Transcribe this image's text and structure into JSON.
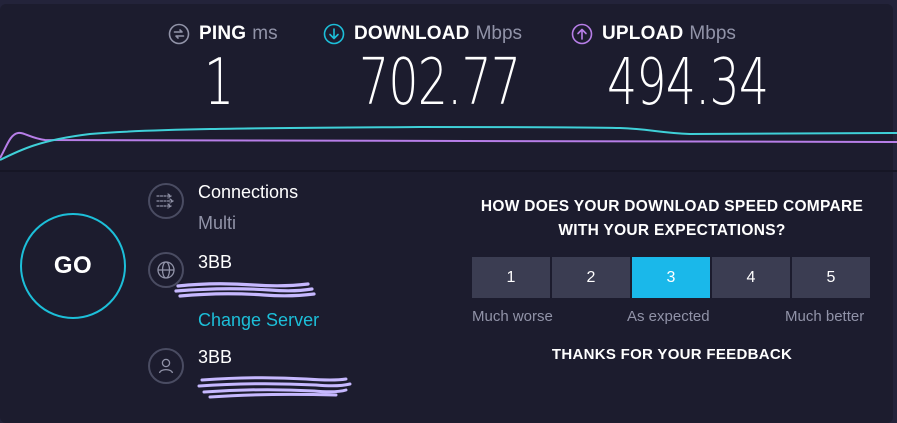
{
  "metrics": {
    "ping": {
      "label": "PING",
      "unit": "ms",
      "value": "1",
      "icon": "ping-icon",
      "color": "#9193a8"
    },
    "download": {
      "label": "DOWNLOAD",
      "unit": "Mbps",
      "value": "702.77",
      "icon": "download-arrow-icon",
      "color": "#1cbfd9"
    },
    "upload": {
      "label": "UPLOAD",
      "unit": "Mbps",
      "value": "494.34",
      "icon": "upload-arrow-icon",
      "color": "#b77ee8"
    }
  },
  "go_label": "GO",
  "connections": {
    "title": "Connections",
    "mode": "Multi"
  },
  "server": {
    "isp": "3BB",
    "change_link": "Change Server"
  },
  "user": {
    "isp": "3BB"
  },
  "feedback": {
    "question_line1": "HOW DOES YOUR DOWNLOAD SPEED COMPARE",
    "question_line2": "WITH YOUR EXPECTATIONS?",
    "options": [
      "1",
      "2",
      "3",
      "4",
      "5"
    ],
    "selected": "3",
    "label_low": "Much worse",
    "label_mid": "As expected",
    "label_high": "Much better",
    "thanks": "THANKS FOR YOUR FEEDBACK"
  },
  "colors": {
    "background": "#1c1c2e",
    "accent": "#1cbfd9",
    "upload": "#b77ee8",
    "selected_option": "#1ab8ea",
    "redaction": "#c6b8ff"
  }
}
